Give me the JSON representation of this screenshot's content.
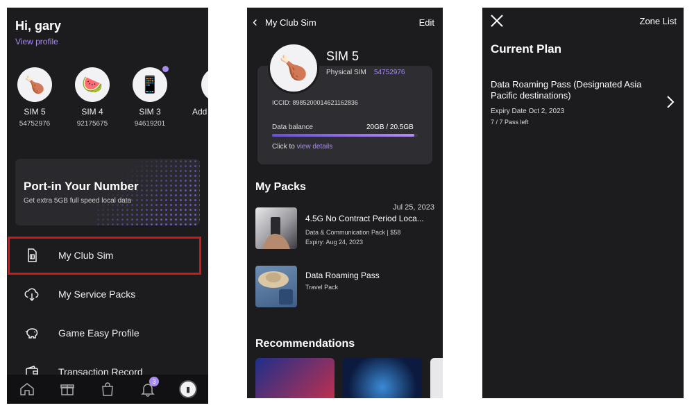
{
  "screen1": {
    "greeting": "Hi, gary",
    "view_profile": "View profile",
    "sims": [
      {
        "name": "SIM 5",
        "number": "54752976",
        "icon": "drumstick-icon"
      },
      {
        "name": "SIM 4",
        "number": "92175675",
        "icon": "watermelon-icon"
      },
      {
        "name": "SIM 3",
        "number": "94619201",
        "icon": "phone-icon"
      },
      {
        "name": "Add",
        "number": "",
        "icon": "add-icon"
      }
    ],
    "promo": {
      "title": "Port-in Your Number",
      "subtitle": "Get extra 5GB full speed local data"
    },
    "menu": [
      {
        "label": "My Club Sim",
        "icon": "sim-card-icon"
      },
      {
        "label": "My Service Packs",
        "icon": "cloud-download-icon"
      },
      {
        "label": "Game Easy Profile",
        "icon": "piggy-bank-icon"
      },
      {
        "label": "Transaction Record",
        "icon": "wallet-icon"
      }
    ],
    "tabbar": {
      "items": [
        "home-icon",
        "gift-icon",
        "shopping-bag-icon",
        "bell-icon",
        "avatar"
      ],
      "notification_count": "3"
    },
    "highlight_color": "#d01818",
    "accent_color": "#a88cf0"
  },
  "screen2": {
    "back": "‹",
    "title": "My Club Sim",
    "edit": "Edit",
    "sim": {
      "name": "SIM 5",
      "type_label": "Physical SIM",
      "number": "54752976",
      "iccid": "ICCID: 8985200014621162836",
      "balance_label": "Data balance",
      "balance_value": "20GB / 20.5GB",
      "balance_fraction": 0.976,
      "click_text": "Click to",
      "details_link": "view details"
    },
    "packs_title": "My Packs",
    "packs": [
      {
        "date": "Jul 25, 2023",
        "name": "4.5G No Contract Period Loca...",
        "line1": "Data & Communication Pack | $58",
        "line2": "Expiry: Aug 24, 2023"
      },
      {
        "name": "Data Roaming Pass",
        "line1": "Travel Pack"
      }
    ],
    "recommendations_title": "Recommendations"
  },
  "screen3": {
    "zone_list": "Zone List",
    "heading": "Current Plan",
    "plan": {
      "name": "Data Roaming Pass (Designated Asia Pacific destinations)",
      "expiry_label": "Expiry Date",
      "expiry_date": "Oct 2, 2023",
      "passes_left": "7 / 7 Pass left"
    }
  }
}
